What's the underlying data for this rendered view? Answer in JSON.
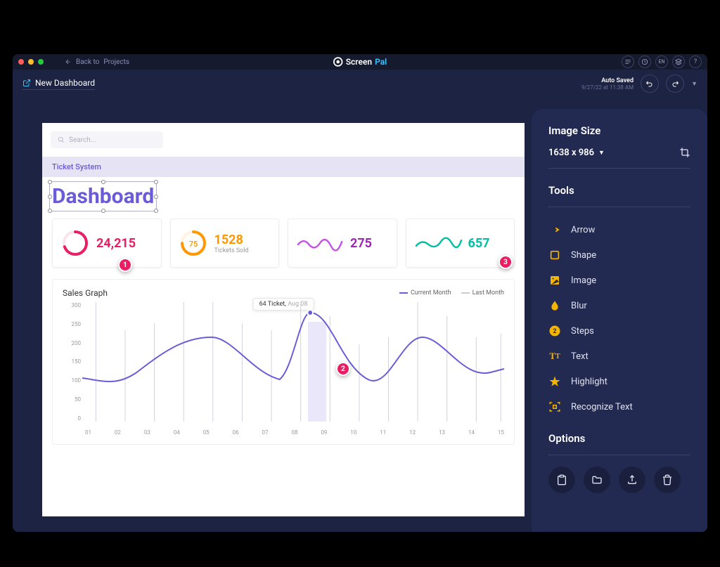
{
  "titlebar": {
    "back_to": "Back to",
    "projects": "Projects",
    "app_name_a": "Screen",
    "app_name_b": "Pal",
    "lang": "EN"
  },
  "subheader": {
    "doc_title": "New Dashboard",
    "auto_saved": "Auto Saved",
    "saved_time": "9/27/22 at 11:38 AM"
  },
  "screenshot": {
    "search_placeholder": "Search...",
    "breadcrumb": "Ticket System",
    "page_title": "Dashboard",
    "cards": {
      "c1_value": "24,215",
      "c2_ring": "75",
      "c2_value": "1528",
      "c2_label": "Tickets Sold",
      "c3_value": "275",
      "c4_value": "657"
    },
    "sales": {
      "title": "Sales Graph",
      "legend_a": "Current Month",
      "legend_b": "Last Month",
      "tooltip_value": "64 Ticket,",
      "tooltip_date": " Aug 08"
    },
    "steps": {
      "s1": "1",
      "s2": "2",
      "s3": "3"
    }
  },
  "chart_data": {
    "type": "line",
    "title": "Sales Graph",
    "xlabel": "",
    "ylabel": "",
    "ylim": [
      0,
      300
    ],
    "x": [
      "01",
      "02",
      "03",
      "04",
      "05",
      "06",
      "07",
      "08",
      "09",
      "10",
      "11",
      "12",
      "13",
      "14",
      "15"
    ],
    "series": [
      {
        "name": "Current Month",
        "values": [
          110,
          100,
          130,
          210,
          230,
          170,
          120,
          280,
          200,
          100,
          120,
          250,
          200,
          130,
          140
        ]
      }
    ],
    "tooltip": {
      "value": 64,
      "label": "Ticket",
      "date": "Aug 08",
      "index": 7
    }
  },
  "panel": {
    "image_size_title": "Image Size",
    "dimensions": "1638 x 986",
    "tools_title": "Tools",
    "tool_arrow": "Arrow",
    "tool_shape": "Shape",
    "tool_image": "Image",
    "tool_blur": "Blur",
    "tool_steps": "Steps",
    "tool_text": "Text",
    "tool_highlight": "Highlight",
    "tool_recognize": "Recognize Text",
    "options_title": "Options"
  }
}
